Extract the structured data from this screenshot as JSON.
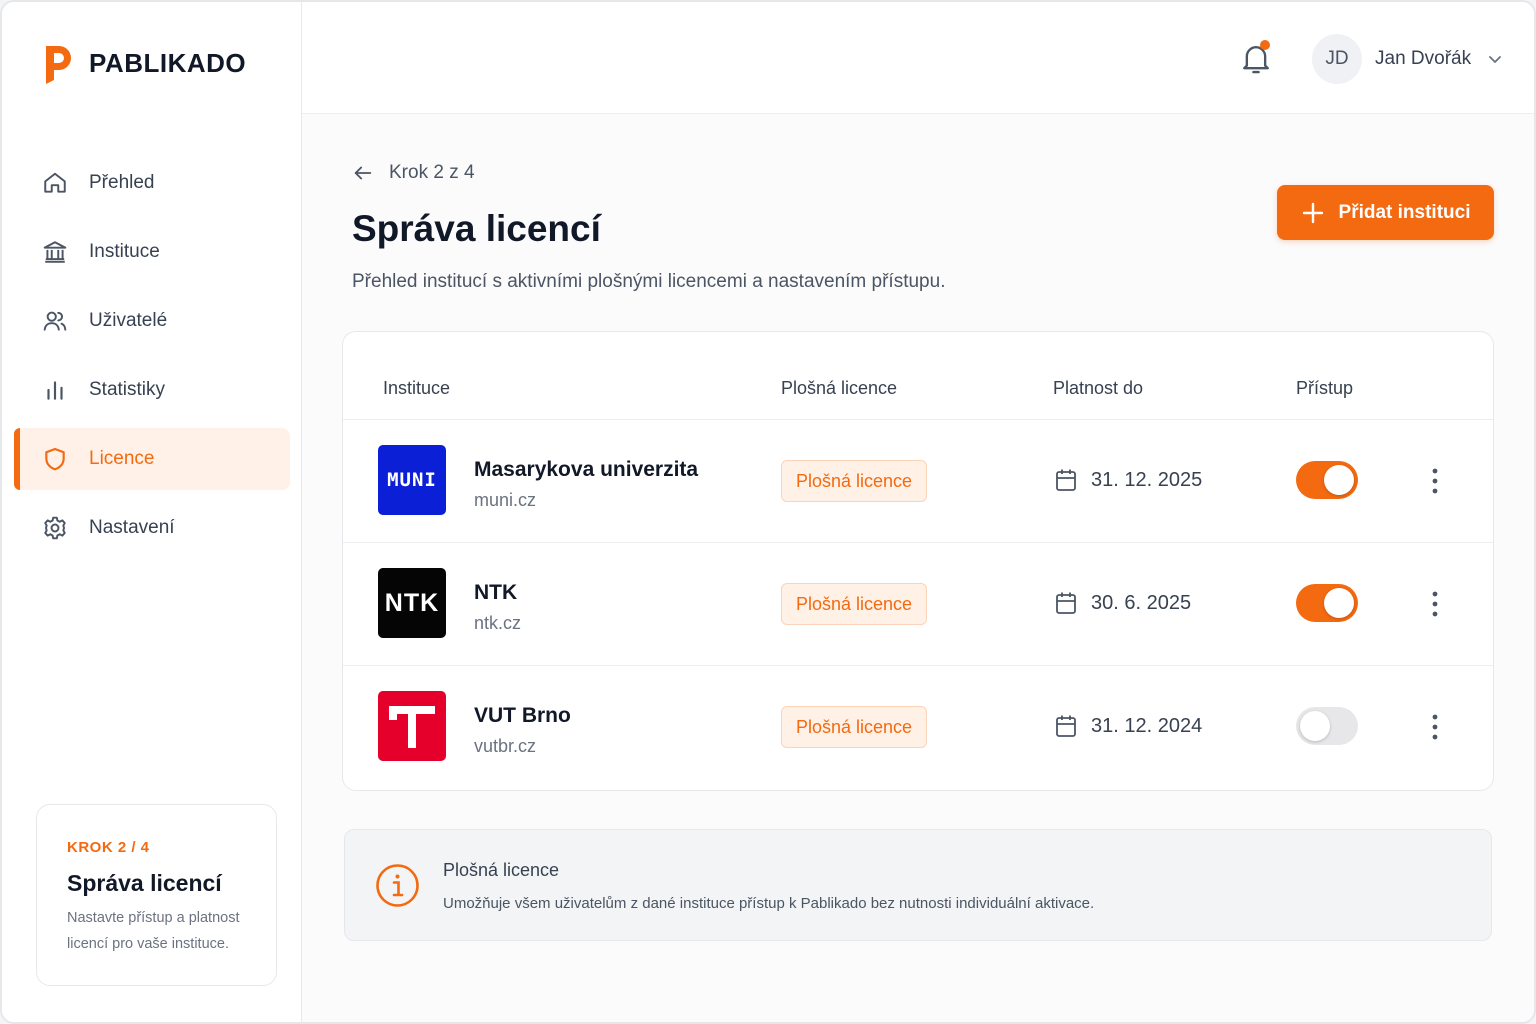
{
  "brand": {
    "name": "PABLIKADO"
  },
  "colors": {
    "accent": "#f36a10",
    "accent_soft": "#fff1e8"
  },
  "sidebar": {
    "items": [
      {
        "label": "Přehled",
        "icon": "home-icon",
        "active": false
      },
      {
        "label": "Instituce",
        "icon": "bank-icon",
        "active": false
      },
      {
        "label": "Uživatelé",
        "icon": "users-icon",
        "active": false
      },
      {
        "label": "Statistiky",
        "icon": "bar-chart-icon",
        "active": false
      },
      {
        "label": "Licence",
        "icon": "shield-icon",
        "active": true
      },
      {
        "label": "Nastavení",
        "icon": "gear-icon",
        "active": false
      }
    ],
    "step_card": {
      "label": "KROK 2 / 4",
      "title": "Správa licencí",
      "description": "Nastavte přístup a platnost licencí pro vaše instituce."
    }
  },
  "header": {
    "notifications_icon": "bell-icon",
    "user": {
      "initials": "JD",
      "name": "Jan Dvořák"
    }
  },
  "main": {
    "back_label": "Krok 2 z 4",
    "title": "Správa licencí",
    "subtitle": "Přehled institucí s aktivními plošnými licencemi a nastavením přístupu.",
    "add_button_label": "Přidat instituci",
    "table": {
      "headers": [
        "Instituce",
        "Plošná licence",
        "Platnost do",
        "Přístup"
      ],
      "rows": [
        {
          "name": "Masarykova univerzita",
          "domain": "muni.cz",
          "logo_text": "MUNI",
          "license": "Plošná licence",
          "valid_until": "31. 12. 2025",
          "access": true
        },
        {
          "name": "NTK",
          "domain": "ntk.cz",
          "logo_text": "NTK",
          "license": "Plošná licence",
          "valid_until": "30. 6. 2025",
          "access": true
        },
        {
          "name": "VUT Brno",
          "domain": "vutbr.cz",
          "logo_text": "",
          "license": "Plošná licence",
          "valid_until": "31. 12. 2024",
          "access": false
        }
      ]
    },
    "info": {
      "title": "Plošná licence",
      "text": "Umožňuje všem uživatelům z dané instituce přístup k Pablikado bez nutnosti individuální aktivace."
    }
  }
}
